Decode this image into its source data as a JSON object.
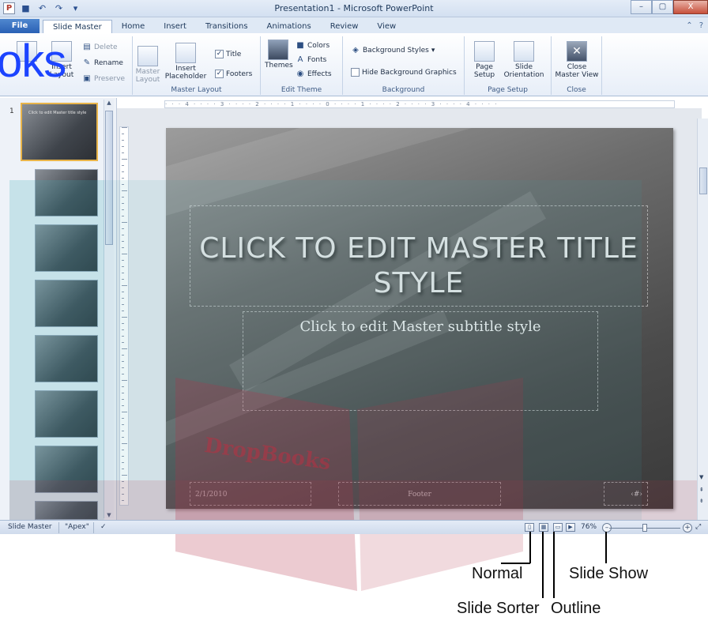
{
  "window": {
    "title": "Presentation1  -  Microsoft PowerPoint",
    "minimize": "–",
    "restore": "▢",
    "close": "X"
  },
  "tabs": {
    "file": "File",
    "items": [
      "Slide Master",
      "Home",
      "Insert",
      "Transitions",
      "Animations",
      "Review",
      "View"
    ],
    "active": "Slide Master"
  },
  "ribbon": {
    "edit_master": {
      "delete": "Delete",
      "rename": "Rename",
      "preserve": "Preserve",
      "insert_layout_1": "Insert",
      "insert_layout_2": "Layout"
    },
    "master_layout": {
      "master_layout_1": "Master",
      "master_layout_2": "Layout",
      "insert_placeholder_1": "Insert",
      "insert_placeholder_2": "Placeholder",
      "title_check": "Title",
      "footers_check": "Footers",
      "label": "Master Layout"
    },
    "edit_theme": {
      "themes": "Themes",
      "colors": "Colors",
      "fonts": "Fonts",
      "effects": "Effects",
      "label": "Edit Theme"
    },
    "background": {
      "styles": "Background Styles",
      "hide": "Hide Background Graphics",
      "label": "Background"
    },
    "page_setup": {
      "page_setup_1": "Page",
      "page_setup_2": "Setup",
      "orientation_1": "Slide",
      "orientation_2": "Orientation",
      "label": "Page Setup"
    },
    "close": {
      "close_1": "Close",
      "close_2": "Master View",
      "label": "Close"
    }
  },
  "thumbnails": {
    "first_number": "1",
    "mini_title": "Click to edit Master title style"
  },
  "slide": {
    "title": "CLICK TO EDIT MASTER TITLE STYLE",
    "subtitle": "Click to edit Master subtitle style",
    "date": "2/1/2010",
    "footer": "Footer",
    "number": "‹#›"
  },
  "statusbar": {
    "view": "Slide Master",
    "theme": "\"Apex\"",
    "zoom": "76%"
  },
  "callouts": {
    "normal": "Normal",
    "slide_sorter": "Slide Sorter",
    "outline": "Outline",
    "slide_show": "Slide Show"
  },
  "watermark": {
    "left_text": "oks",
    "dropbooks": "DropBooks"
  },
  "colors": {
    "watermark_blue": "#1c44ff",
    "watermark_teal": "#3aa7b4",
    "watermark_red": "#b43048",
    "file_tab": "#2a61b5"
  }
}
